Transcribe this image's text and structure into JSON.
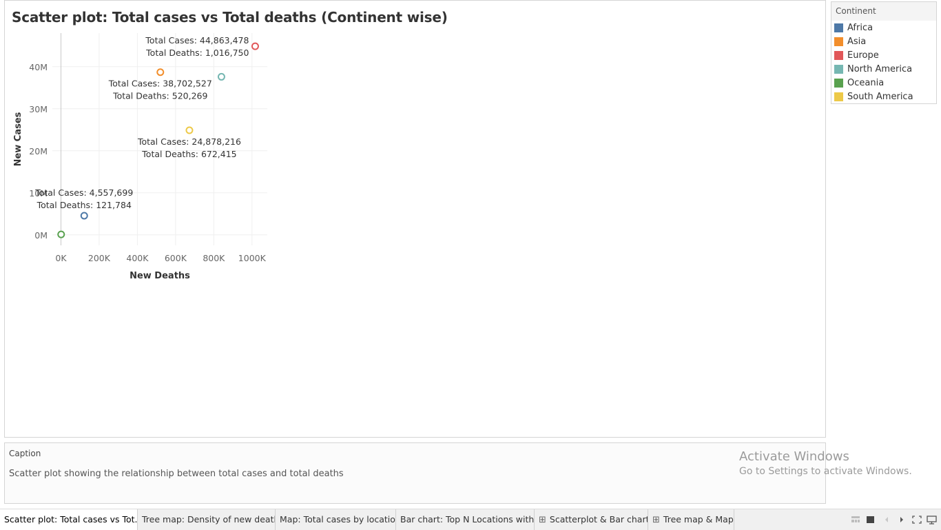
{
  "title": "Scatter plot: Total cases vs Total deaths (Continent wise)",
  "legend": {
    "title": "Continent",
    "items": [
      {
        "label": "Africa",
        "color": "#4e79a7"
      },
      {
        "label": "Asia",
        "color": "#f28e2b"
      },
      {
        "label": "Europe",
        "color": "#e15759"
      },
      {
        "label": "North America",
        "color": "#76b7b2"
      },
      {
        "label": "Oceania",
        "color": "#59a14f"
      },
      {
        "label": "South America",
        "color": "#edc948"
      }
    ]
  },
  "chart_data": {
    "type": "scatter",
    "xlabel": "New Deaths",
    "ylabel": "New Cases",
    "xlim": [
      -45000,
      1080000
    ],
    "ylim": [
      -2500000,
      48000000
    ],
    "x_ticks": [
      {
        "v": 0,
        "label": "0K"
      },
      {
        "v": 200000,
        "label": "200K"
      },
      {
        "v": 400000,
        "label": "400K"
      },
      {
        "v": 600000,
        "label": "600K"
      },
      {
        "v": 800000,
        "label": "800K"
      },
      {
        "v": 1000000,
        "label": "1000K"
      }
    ],
    "y_ticks": [
      {
        "v": 0,
        "label": "0M"
      },
      {
        "v": 10000000,
        "label": "10M"
      },
      {
        "v": 20000000,
        "label": "20M"
      },
      {
        "v": 30000000,
        "label": "30M"
      },
      {
        "v": 40000000,
        "label": "40M"
      }
    ],
    "grid": true,
    "points": [
      {
        "series": "Africa",
        "x": 121784,
        "y": 4557699,
        "color": "#4e79a7",
        "label_lines": [
          "Total Cases: 4,557,699",
          "Total Deaths: 121,784"
        ],
        "label_pos": "above"
      },
      {
        "series": "Asia",
        "x": 520269,
        "y": 38702527,
        "color": "#f28e2b",
        "label_lines": [
          "Total Cases: 38,702,527",
          "Total Deaths: 520,269"
        ],
        "label_pos": "below"
      },
      {
        "series": "Europe",
        "x": 1016750,
        "y": 44863478,
        "color": "#e15759",
        "label_lines": [
          "Total Cases: 44,863,478",
          "Total Deaths: 1,016,750"
        ],
        "label_pos": "left"
      },
      {
        "series": "North America",
        "x": 840000,
        "y": 37600000,
        "color": "#76b7b2",
        "label_lines": [],
        "label_pos": "none"
      },
      {
        "series": "Oceania",
        "x": 1000,
        "y": 100000,
        "color": "#59a14f",
        "label_lines": [],
        "label_pos": "none"
      },
      {
        "series": "South America",
        "x": 672415,
        "y": 24878216,
        "color": "#edc948",
        "label_lines": [
          "Total Cases: 24,878,216",
          "Total Deaths: 672,415"
        ],
        "label_pos": "below"
      }
    ]
  },
  "caption": {
    "title": "Caption",
    "text": "Scatter plot showing the relationship between total cases and total deaths"
  },
  "watermark": {
    "title": "Activate Windows",
    "subtitle": "Go to Settings to activate Windows."
  },
  "tabs": [
    {
      "label": "Scatter plot: Total cases vs Tot...",
      "active": true,
      "icon": ""
    },
    {
      "label": "Tree map: Density of new death...",
      "active": false,
      "icon": ""
    },
    {
      "label": "Map: Total cases by location",
      "active": false,
      "icon": ""
    },
    {
      "label": "Bar chart: Top N Locations with ...",
      "active": false,
      "icon": ""
    },
    {
      "label": "Scatterplot & Bar chart",
      "active": false,
      "icon": "dashboard-icon"
    },
    {
      "label": "Tree map & Map",
      "active": false,
      "icon": "dashboard-icon"
    }
  ]
}
